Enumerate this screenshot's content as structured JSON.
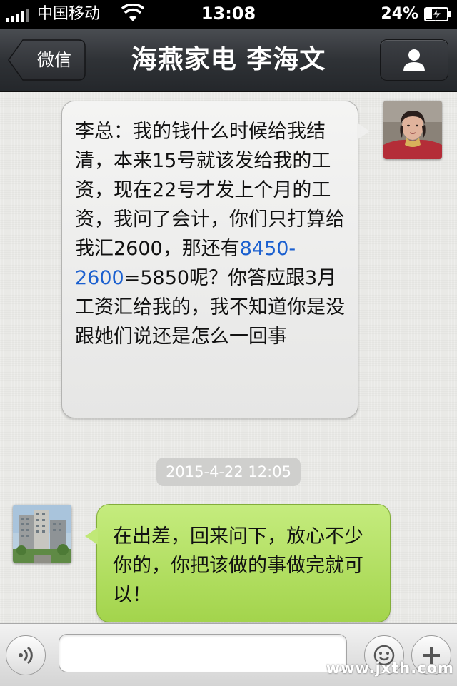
{
  "status_bar": {
    "carrier": "中国移动",
    "time": "13:08",
    "battery_percent": "24%",
    "signal_bars": 4,
    "icons": [
      "signal-icon",
      "wifi-icon",
      "battery-charging-icon"
    ]
  },
  "nav": {
    "back_label": "微信",
    "title": "海燕家电 李海文",
    "profile_icon": "person-icon"
  },
  "messages": [
    {
      "direction": "incoming",
      "avatar": "woman-avatar",
      "text_before": "李总：我的钱什么时候给我结清，本来15号就该发给我的工资，现在22号才发上个月的工资，我问了会计，你们只打算给我汇2600，那还有",
      "link_text": "8450-2600",
      "text_after": "=5850呢？你答应跟3月工资汇给我的，我不知道你是没跟她们说还是怎么一回事"
    },
    {
      "direction": "timestamp",
      "text": "2015-4-22 12:05"
    },
    {
      "direction": "outgoing",
      "avatar": "building-avatar",
      "text": "在出差，回来问下，放心不少你的，你把该做的事做完就可以！"
    }
  ],
  "input_bar": {
    "placeholder": "",
    "icons": [
      "voice-icon",
      "emoji-icon",
      "plus-icon"
    ],
    "watermark": "www.jxth.com"
  },
  "colors": {
    "nav_background": "#2f3236",
    "incoming_bubble": "#ececeb",
    "outgoing_bubble": "#b2df62",
    "link": "#1a5fcf",
    "timestamp_bg": "#cfcfcd"
  }
}
